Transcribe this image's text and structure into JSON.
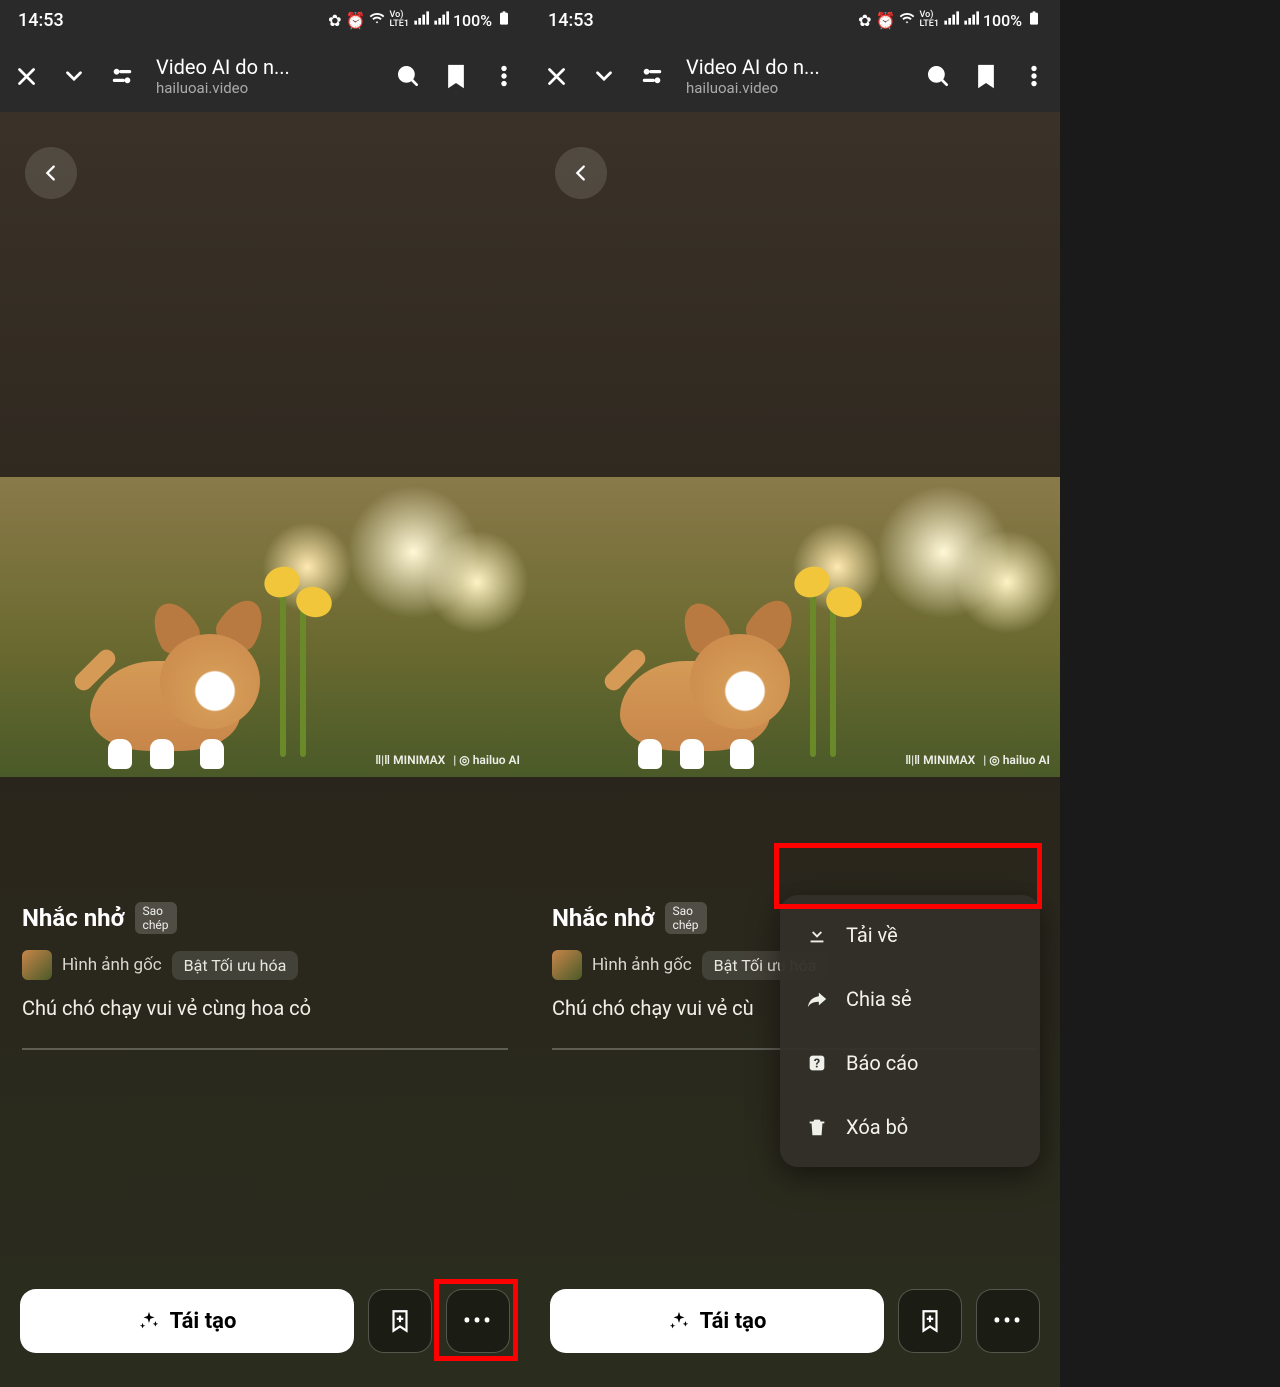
{
  "status": {
    "time": "14:53",
    "battery": "100%"
  },
  "chrome": {
    "title": "Video AI do n...",
    "subtitle": "hailuoai.video"
  },
  "watermark": {
    "brand1": "MINIMAX",
    "brand2": "hailuo AI"
  },
  "info": {
    "reminder_label": "Nhắc nhở",
    "copy_l1": "Sao",
    "copy_l2": "chép",
    "tag_original": "Hình ảnh gốc",
    "tag_optimize": "Bật Tối ưu hóa",
    "prompt_full": "Chú chó chạy vui vẻ cùng hoa cỏ",
    "prompt_trunc": "Chú chó chạy vui vẻ cù"
  },
  "actions": {
    "regenerate": "Tái tạo"
  },
  "menu": {
    "download": "Tải về",
    "share": "Chia sẻ",
    "report": "Báo cáo",
    "delete": "Xóa bỏ"
  }
}
